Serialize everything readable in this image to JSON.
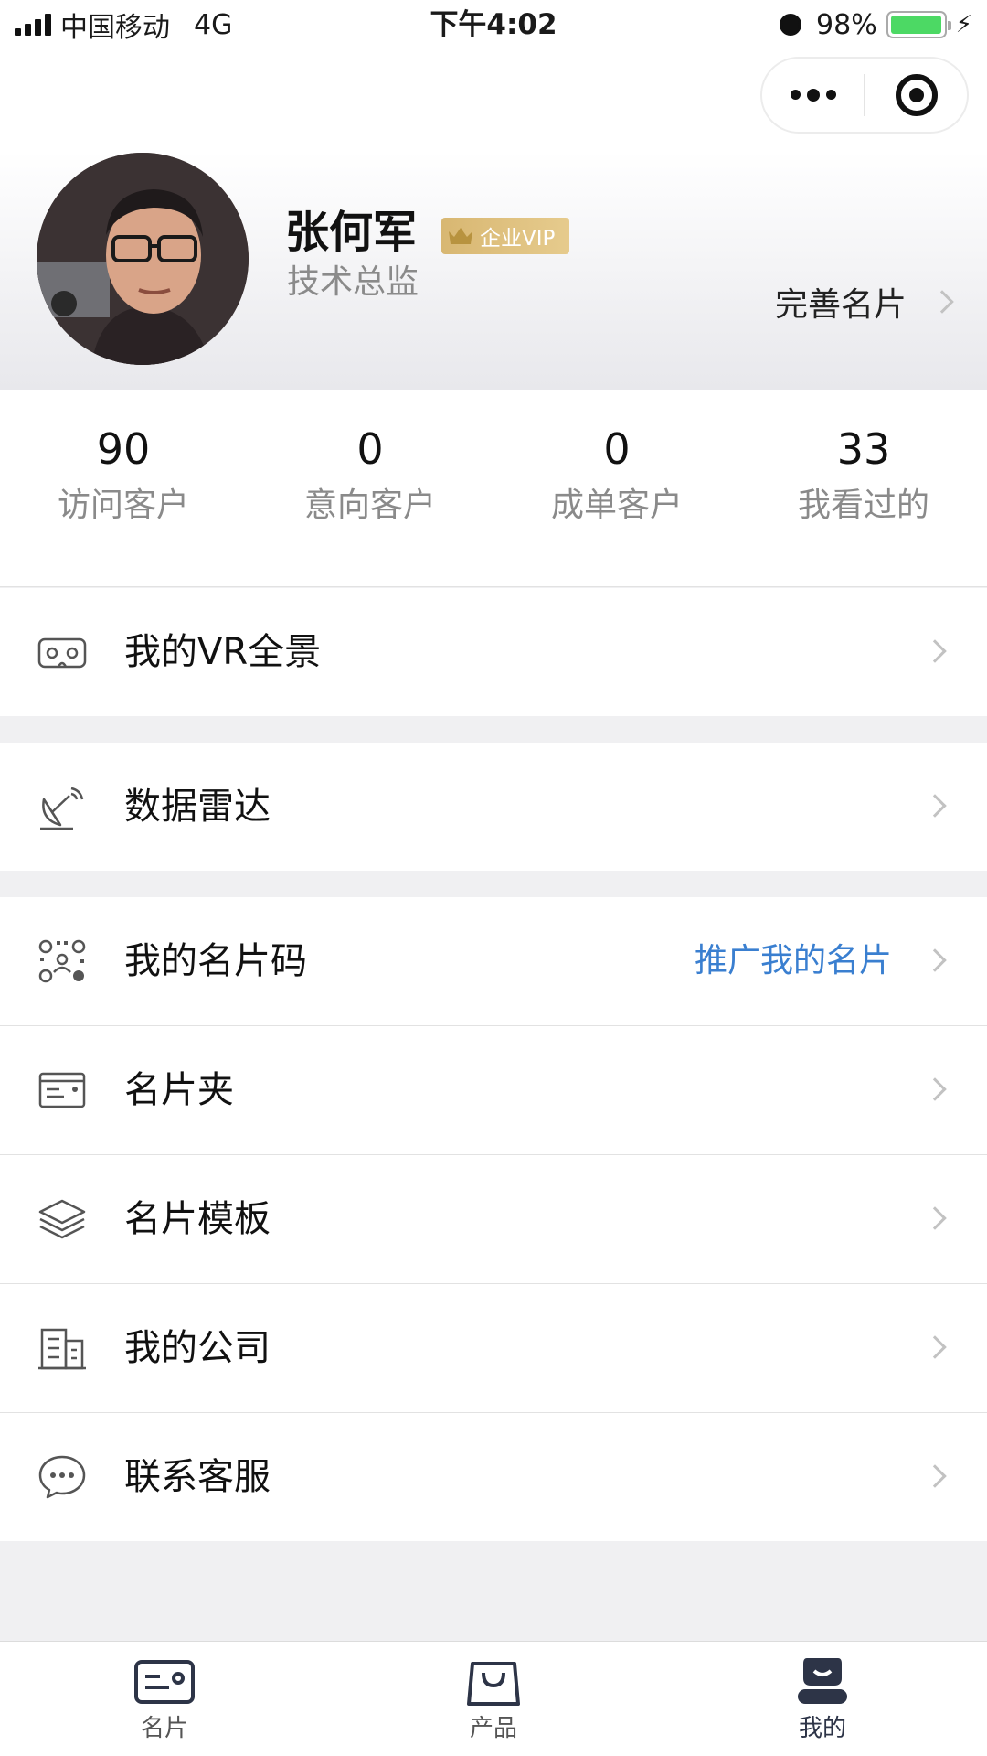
{
  "status_bar": {
    "carrier": "中国移动",
    "network": "4G",
    "time": "下午4:02",
    "battery": "98%",
    "battery_level": 0.98
  },
  "capsule": {
    "more_icon": "more-dots-icon",
    "close_icon": "target-circle-icon"
  },
  "profile": {
    "name": "张何军",
    "vip_badge": "企业VIP",
    "title": "技术总监",
    "complete_card_label": "完善名片"
  },
  "stats": [
    {
      "value": "90",
      "label": "访问客户"
    },
    {
      "value": "0",
      "label": "意向客户"
    },
    {
      "value": "0",
      "label": "成单客户"
    },
    {
      "value": "33",
      "label": "我看过的"
    }
  ],
  "menu": {
    "vr": {
      "label": "我的VR全景",
      "icon": "vr-goggles-icon"
    },
    "radar": {
      "label": "数据雷达",
      "icon": "satellite-dish-icon"
    },
    "card_code": {
      "label": "我的名片码",
      "extra": "推广我的名片",
      "icon": "qr-code-icon"
    },
    "card_holder": {
      "label": "名片夹",
      "icon": "card-holder-icon"
    },
    "templates": {
      "label": "名片模板",
      "icon": "layers-icon"
    },
    "company": {
      "label": "我的公司",
      "icon": "building-icon"
    },
    "service": {
      "label": "联系客服",
      "icon": "chat-bubble-icon"
    }
  },
  "tabbar": [
    {
      "label": "名片",
      "icon": "card-icon"
    },
    {
      "label": "产品",
      "icon": "shopping-bag-icon"
    },
    {
      "label": "我的",
      "icon": "user-icon",
      "active": true
    }
  ],
  "colors": {
    "accent_link": "#3a7fd0",
    "vip_gold": "#d8b772",
    "battery_green": "#4cd964",
    "background": "#f0f0f2"
  }
}
